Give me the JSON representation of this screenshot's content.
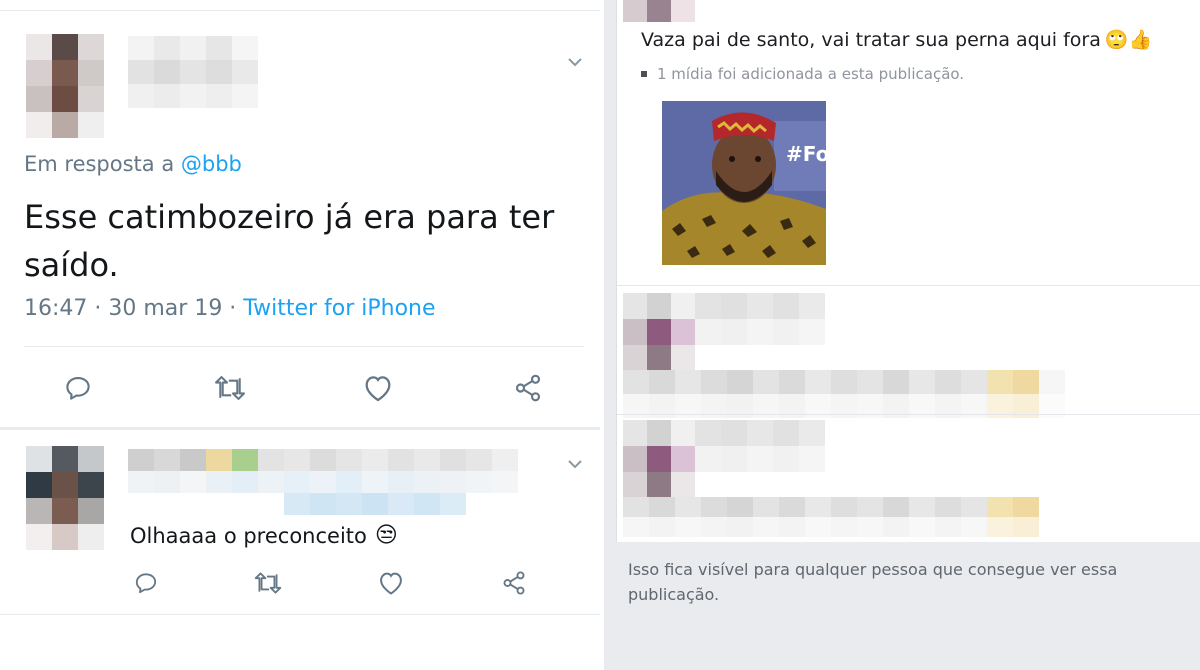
{
  "left": {
    "tweet": {
      "reply_prefix": "Em resposta a",
      "reply_handle": "@bbb",
      "text": "Esse catimbozeiro já era para ter saído.",
      "time": "16:47 · 30 mar 19 · ",
      "source": "Twitter for iPhone",
      "actions": [
        "reply-icon",
        "retweet-icon",
        "like-icon",
        "share-icon"
      ]
    },
    "reply": {
      "text": "Olhaaaa o preconceito",
      "emoji": "😒",
      "actions": [
        "reply-icon",
        "retweet-icon",
        "like-icon",
        "share-icon"
      ]
    }
  },
  "right": {
    "post": {
      "text": "Vaza pai de santo, vai tratar sua perna aqui fora",
      "emojis": "🙄👍",
      "media_note": "1 mídia foi adicionada a esta publicação.",
      "media_caption": "#Fo"
    },
    "footer": "Isso fica visível para qualquer pessoa que consegue ver essa publicação."
  },
  "colors": {
    "link_blue": "#1da1f2",
    "secondary_gray": "#657786",
    "panel_bg": "#e9ebee"
  }
}
